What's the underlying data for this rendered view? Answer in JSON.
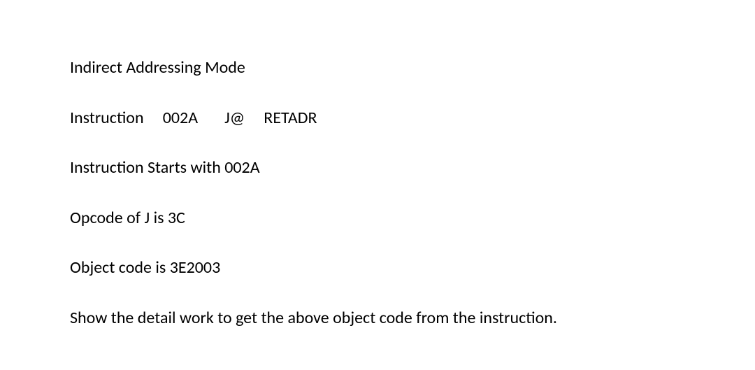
{
  "title": "Indirect Addressing Mode",
  "instruction_line": "Instruction     002A       J@     RETADR",
  "starts_line": "Instruction Starts with 002A",
  "opcode_line": "Opcode of J is 3C",
  "objectcode_line": "Object code is 3E2003",
  "question_line": "Show the detail work to get the above object code from the instruction."
}
